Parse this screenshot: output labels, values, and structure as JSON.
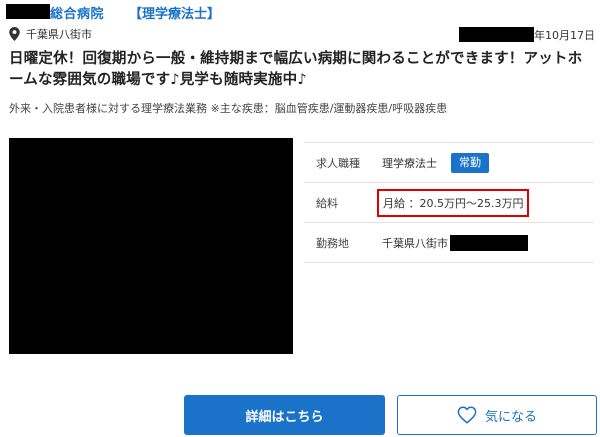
{
  "header": {
    "hospital_suffix": "総合病院",
    "job_tag": "【理学療法士】"
  },
  "location": {
    "icon": "map-pin-icon",
    "text": "千葉県八街市"
  },
  "posted_date": {
    "suffix": "年10月17日"
  },
  "headline": "日曜定休！回復期から一般・維持期まで幅広い病期に関わることができます！アットホームな雰囲気の職場です♪見学も随時実施中♪",
  "description": "外来・入院患者様に対する理学療法業務 ※主な疾患：脳血管疾患/運動器疾患/呼吸器疾患",
  "info": {
    "job_type": {
      "label": "求人職種",
      "value": "理学療法士",
      "badge": "常勤"
    },
    "salary": {
      "label": "給料",
      "value": "月給 ：20.5万円〜25.3万円"
    },
    "workplace": {
      "label": "勤務地",
      "value": "千葉県八街市"
    }
  },
  "buttons": {
    "detail_label": "詳細はこちら",
    "favorite_label": "気になる",
    "favorite_icon": "heart-icon"
  },
  "colors": {
    "accent": "#1a73c8",
    "highlight_border": "#e00000"
  }
}
